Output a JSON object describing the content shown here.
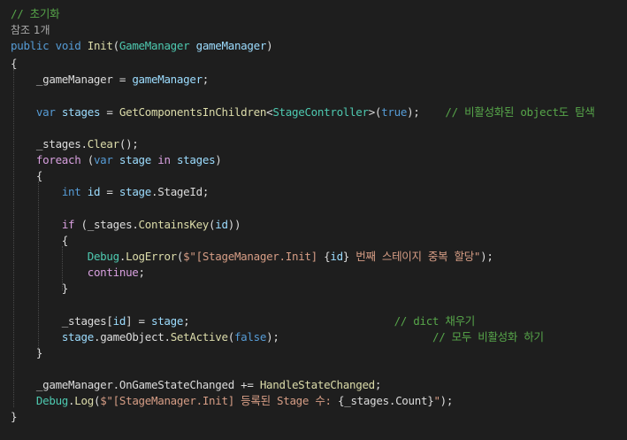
{
  "editor": {
    "lines": [
      [
        {
          "t": "// 초기화",
          "c": "comment"
        }
      ],
      [
        {
          "t": "참조 1개",
          "c": "ref"
        }
      ],
      [
        {
          "t": "public",
          "c": "kw"
        },
        {
          "t": " ",
          "c": "plain"
        },
        {
          "t": "void",
          "c": "kw"
        },
        {
          "t": " ",
          "c": "plain"
        },
        {
          "t": "Init",
          "c": "method"
        },
        {
          "t": "(",
          "c": "plain"
        },
        {
          "t": "GameManager",
          "c": "type"
        },
        {
          "t": " ",
          "c": "plain"
        },
        {
          "t": "gameManager",
          "c": "var"
        },
        {
          "t": ")",
          "c": "plain"
        }
      ],
      [
        {
          "t": "{",
          "c": "plain"
        }
      ],
      [
        {
          "t": "    _gameManager",
          "c": "field"
        },
        {
          "t": " = ",
          "c": "plain"
        },
        {
          "t": "gameManager",
          "c": "var"
        },
        {
          "t": ";",
          "c": "plain"
        }
      ],
      [],
      [
        {
          "t": "    ",
          "c": "plain"
        },
        {
          "t": "var",
          "c": "kw"
        },
        {
          "t": " ",
          "c": "plain"
        },
        {
          "t": "stages",
          "c": "var"
        },
        {
          "t": " = ",
          "c": "plain"
        },
        {
          "t": "GetComponentsInChildren",
          "c": "method"
        },
        {
          "t": "<",
          "c": "plain"
        },
        {
          "t": "StageController",
          "c": "type"
        },
        {
          "t": ">(",
          "c": "plain"
        },
        {
          "t": "true",
          "c": "kw"
        },
        {
          "t": ");",
          "c": "plain"
        },
        {
          "t": "    ",
          "c": "plain"
        },
        {
          "t": "// 비활성화된 object도 탐색",
          "c": "comment"
        }
      ],
      [],
      [
        {
          "t": "    _stages",
          "c": "field"
        },
        {
          "t": ".",
          "c": "plain"
        },
        {
          "t": "Clear",
          "c": "method"
        },
        {
          "t": "();",
          "c": "plain"
        }
      ],
      [
        {
          "t": "    ",
          "c": "plain"
        },
        {
          "t": "foreach",
          "c": "ctrl"
        },
        {
          "t": " (",
          "c": "plain"
        },
        {
          "t": "var",
          "c": "kw"
        },
        {
          "t": " ",
          "c": "plain"
        },
        {
          "t": "stage",
          "c": "var"
        },
        {
          "t": " ",
          "c": "plain"
        },
        {
          "t": "in",
          "c": "ctrl"
        },
        {
          "t": " ",
          "c": "plain"
        },
        {
          "t": "stages",
          "c": "var"
        },
        {
          "t": ")",
          "c": "plain"
        }
      ],
      [
        {
          "t": "    {",
          "c": "plain"
        }
      ],
      [
        {
          "t": "        ",
          "c": "plain"
        },
        {
          "t": "int",
          "c": "kw"
        },
        {
          "t": " ",
          "c": "plain"
        },
        {
          "t": "id",
          "c": "var"
        },
        {
          "t": " = ",
          "c": "plain"
        },
        {
          "t": "stage",
          "c": "var"
        },
        {
          "t": ".",
          "c": "plain"
        },
        {
          "t": "StageId",
          "c": "plain"
        },
        {
          "t": ";",
          "c": "plain"
        }
      ],
      [],
      [
        {
          "t": "        ",
          "c": "plain"
        },
        {
          "t": "if",
          "c": "ctrl"
        },
        {
          "t": " (",
          "c": "plain"
        },
        {
          "t": "_stages",
          "c": "field"
        },
        {
          "t": ".",
          "c": "plain"
        },
        {
          "t": "ContainsKey",
          "c": "method"
        },
        {
          "t": "(",
          "c": "plain"
        },
        {
          "t": "id",
          "c": "var"
        },
        {
          "t": "))",
          "c": "plain"
        }
      ],
      [
        {
          "t": "        {",
          "c": "plain"
        }
      ],
      [
        {
          "t": "            ",
          "c": "plain"
        },
        {
          "t": "Debug",
          "c": "type"
        },
        {
          "t": ".",
          "c": "plain"
        },
        {
          "t": "LogError",
          "c": "method"
        },
        {
          "t": "(",
          "c": "plain"
        },
        {
          "t": "$\"[StageManager.Init] ",
          "c": "str"
        },
        {
          "t": "{",
          "c": "plain"
        },
        {
          "t": "id",
          "c": "var"
        },
        {
          "t": "}",
          "c": "plain"
        },
        {
          "t": " 번째 스테이지 중복 할당\"",
          "c": "str"
        },
        {
          "t": ");",
          "c": "plain"
        }
      ],
      [
        {
          "t": "            ",
          "c": "plain"
        },
        {
          "t": "continue",
          "c": "ctrl"
        },
        {
          "t": ";",
          "c": "plain"
        }
      ],
      [
        {
          "t": "        }",
          "c": "plain"
        }
      ],
      [],
      [
        {
          "t": "        _stages",
          "c": "field"
        },
        {
          "t": "[",
          "c": "plain"
        },
        {
          "t": "id",
          "c": "var"
        },
        {
          "t": "] = ",
          "c": "plain"
        },
        {
          "t": "stage",
          "c": "var"
        },
        {
          "t": ";",
          "c": "plain"
        },
        {
          "t": "                                // dict 채우기",
          "c": "comment"
        }
      ],
      [
        {
          "t": "        ",
          "c": "plain"
        },
        {
          "t": "stage",
          "c": "var"
        },
        {
          "t": ".",
          "c": "plain"
        },
        {
          "t": "gameObject",
          "c": "plain"
        },
        {
          "t": ".",
          "c": "plain"
        },
        {
          "t": "SetActive",
          "c": "method"
        },
        {
          "t": "(",
          "c": "plain"
        },
        {
          "t": "false",
          "c": "kw"
        },
        {
          "t": ");",
          "c": "plain"
        },
        {
          "t": "                        // 모두 비활성화 하기",
          "c": "comment"
        }
      ],
      [
        {
          "t": "    }",
          "c": "plain"
        }
      ],
      [],
      [
        {
          "t": "    _gameManager",
          "c": "field"
        },
        {
          "t": ".",
          "c": "plain"
        },
        {
          "t": "OnGameStateChanged",
          "c": "plain"
        },
        {
          "t": " += ",
          "c": "plain"
        },
        {
          "t": "HandleStateChanged",
          "c": "method"
        },
        {
          "t": ";",
          "c": "plain"
        }
      ],
      [
        {
          "t": "    ",
          "c": "plain"
        },
        {
          "t": "Debug",
          "c": "type"
        },
        {
          "t": ".",
          "c": "plain"
        },
        {
          "t": "Log",
          "c": "method"
        },
        {
          "t": "(",
          "c": "plain"
        },
        {
          "t": "$\"[StageManager.Init] 등록된 Stage 수: ",
          "c": "str"
        },
        {
          "t": "{",
          "c": "plain"
        },
        {
          "t": "_stages",
          "c": "field"
        },
        {
          "t": ".",
          "c": "plain"
        },
        {
          "t": "Count",
          "c": "plain"
        },
        {
          "t": "}",
          "c": "plain"
        },
        {
          "t": "\"",
          "c": "str"
        },
        {
          "t": ");",
          "c": "plain"
        }
      ],
      [
        {
          "t": "}",
          "c": "plain"
        }
      ]
    ]
  },
  "colors": {
    "background": "#1e1e1e",
    "comment": "#57a64a",
    "keyword": "#569cd6",
    "control": "#d8a0df",
    "type": "#4ec9b0",
    "method": "#dcdcaa",
    "string": "#d69d85",
    "variable": "#9cdcfe",
    "plain": "#dcdcdc"
  }
}
